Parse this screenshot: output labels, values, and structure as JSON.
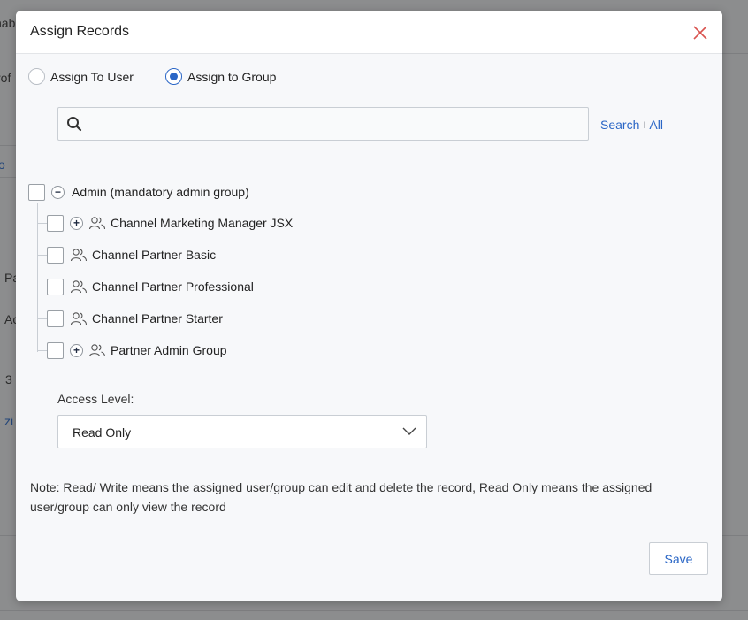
{
  "background": {
    "fragments": [
      "nab",
      "rof",
      "o",
      "Pa",
      "Ac",
      "3",
      "zi"
    ]
  },
  "modal": {
    "title": "Assign Records",
    "close_icon": "close-icon"
  },
  "assign_mode": {
    "options": [
      {
        "label": "Assign To User",
        "selected": false
      },
      {
        "label": "Assign to Group",
        "selected": true
      }
    ]
  },
  "search": {
    "value": "",
    "placeholder": "",
    "search_link": "Search",
    "separator": "I",
    "all_link": "All"
  },
  "tree": {
    "root": {
      "label": "Admin (mandatory admin group)",
      "expanded": true,
      "checked": false
    },
    "children": [
      {
        "label": "Channel Marketing Manager JSX",
        "has_children": true,
        "checked": false
      },
      {
        "label": "Channel Partner Basic",
        "has_children": false,
        "checked": false
      },
      {
        "label": "Channel Partner Professional",
        "has_children": false,
        "checked": false
      },
      {
        "label": "Channel Partner Starter",
        "has_children": false,
        "checked": false
      },
      {
        "label": "Partner Admin Group",
        "has_children": true,
        "checked": false
      }
    ]
  },
  "access": {
    "label": "Access Level:",
    "selected": "Read Only"
  },
  "note": "Note: Read/ Write means the assigned user/group can edit and delete the record, Read Only means the assigned user/group can only view the record",
  "save_label": "Save",
  "colors": {
    "accent": "#2a66c6",
    "close": "#d9534f",
    "overlay": "#8c8d8e"
  }
}
